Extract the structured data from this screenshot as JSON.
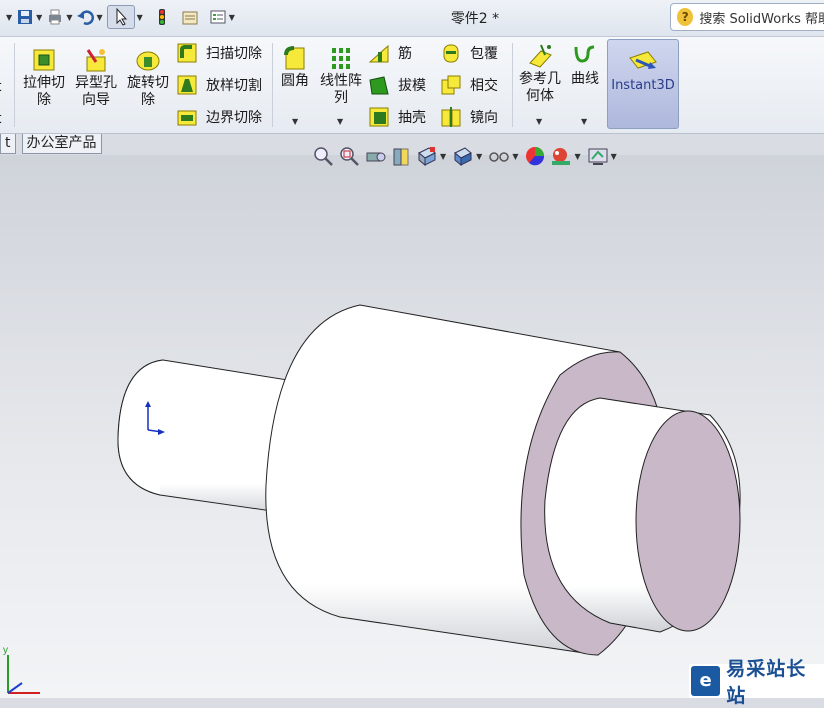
{
  "window": {
    "title": "零件2 *"
  },
  "search": {
    "placeholder": "搜索 SolidWorks 帮助"
  },
  "ribbon": {
    "left_partial": [
      "t",
      "t"
    ],
    "extruded_cut": "拉伸切除",
    "hole_wizard": "异型孔向导",
    "revolved_cut": "旋转切除",
    "swept_cut": "扫描切除",
    "lofted_cut": "放样切割",
    "boundary_cut": "边界切除",
    "fillet": "圆角",
    "linear_pattern": "线性阵列",
    "rib": "筋",
    "draft": "拔模",
    "shell": "抽壳",
    "wrap": "包覆",
    "intersect": "相交",
    "mirror": "镜向",
    "ref_geometry": "参考几何体",
    "curves": "曲线",
    "instant3d": "Instant3D"
  },
  "tabs": [
    "t",
    "办公室产品"
  ],
  "watermark": {
    "name": "易采站长站"
  },
  "colors": {
    "accent": "#2b3d8a",
    "model_face": "#c8b8c8",
    "model_body": "#ffffff"
  }
}
